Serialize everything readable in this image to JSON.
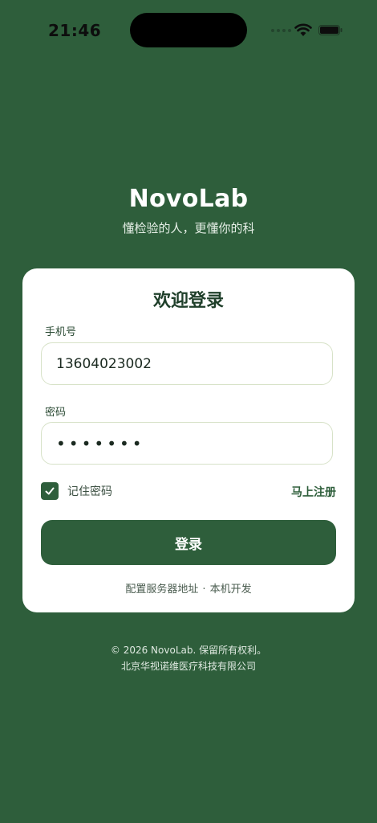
{
  "status_bar": {
    "time": "21:46",
    "icons": [
      "signal-dots-icon",
      "wifi-icon",
      "battery-icon"
    ]
  },
  "brand": {
    "title": "NovoLab",
    "slogan": "懂检验的人，更懂你的科"
  },
  "login_card": {
    "title": "欢迎登录",
    "phone_label": "手机号",
    "phone_value": "13604023002",
    "password_label": "密码",
    "password_value": "•••••••",
    "remember_label": "记住密码",
    "remember_checked": true,
    "register_label": "马上注册",
    "login_button": "登录",
    "server_config": "配置服务器地址",
    "separator": "·",
    "dev_mode": "本机开发"
  },
  "footer": {
    "copyright": "© 2026 NovoLab. 保留所有权利。",
    "company": "北京华视诺维医疗科技有限公司"
  },
  "colors": {
    "background": "#2e5e3b",
    "card": "#ffffff",
    "accent": "#2e5e3b",
    "field_border": "#d7e2c8"
  }
}
